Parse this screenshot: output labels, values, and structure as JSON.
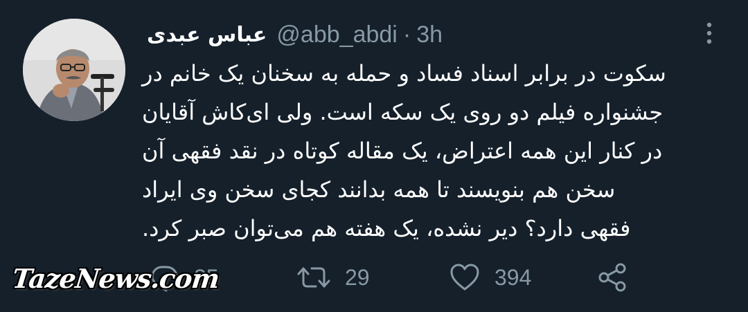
{
  "tweet": {
    "display_name": "عباس عبدی",
    "handle": "@abb_abdi",
    "separator": "·",
    "time": "3h",
    "text": "سکوت در برابر اسناد فساد و حمله به سخنان یک خانم در\nجشنواره فیلم دو روی یک سکه است. ولی ای‌کاش آقایان\nدر کنار این همه اعتراض، یک مقاله کوتاه در نقد فقهی آن\nسخن هم بنویسند تا همه بدانند کجای سخن وی ایراد\nفقهی دارد؟ دیر نشده، یک هفته هم می‌توان صبر کرد."
  },
  "actions": {
    "reply_count": "35",
    "retweet_count": "29",
    "like_count": "394"
  },
  "icons": {
    "more": "more-vertical-icon",
    "reply": "reply-icon",
    "retweet": "retweet-icon",
    "like": "heart-icon",
    "share": "share-icon"
  },
  "colors": {
    "background": "#15202b",
    "text": "#ffffff",
    "secondary": "#8899a6"
  },
  "watermark": "TazeNews.com"
}
